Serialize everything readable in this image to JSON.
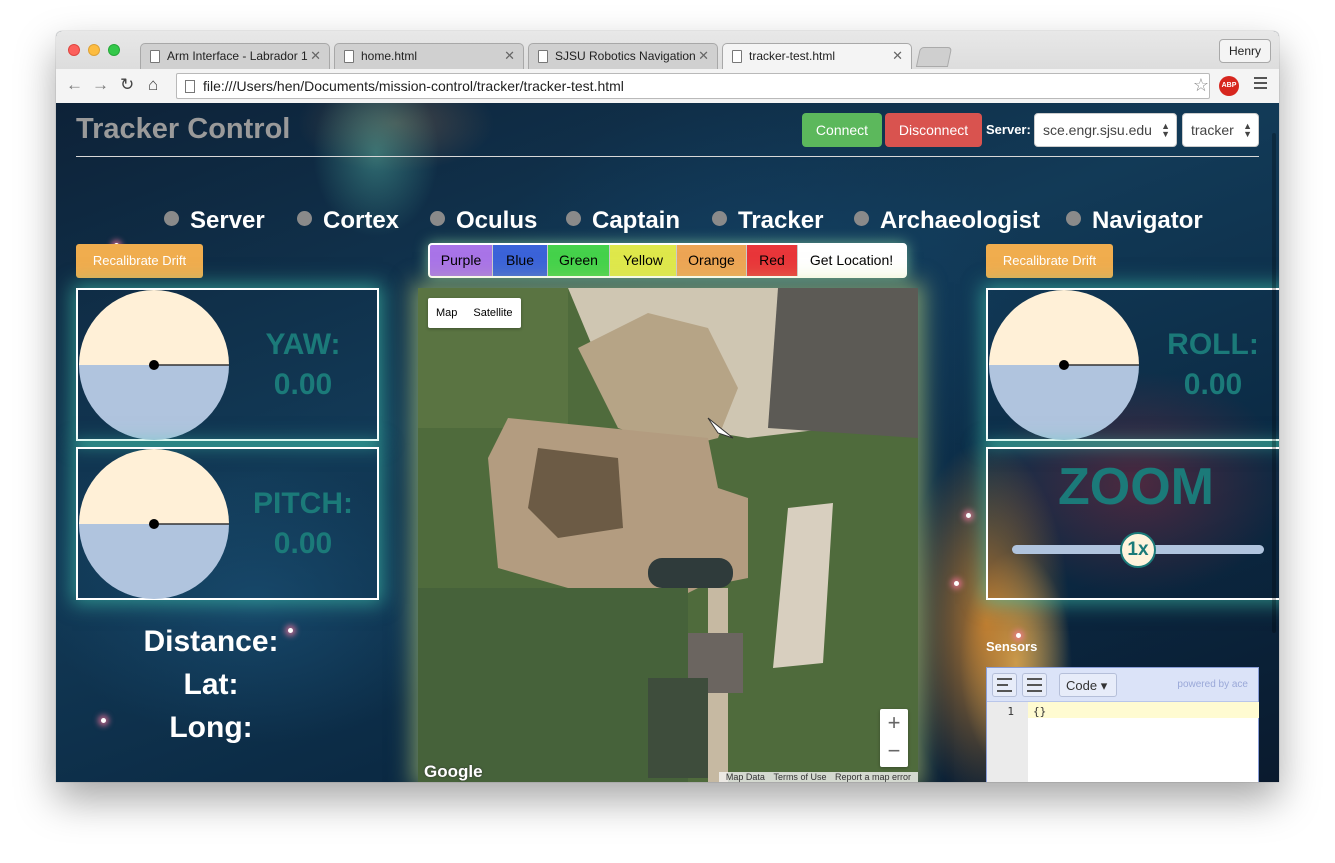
{
  "browser": {
    "tabs": [
      {
        "title": "Arm Interface - Labrador 1"
      },
      {
        "title": "home.html"
      },
      {
        "title": "SJSU Robotics Navigation"
      },
      {
        "title": "tracker-test.html"
      }
    ],
    "profile": "Henry",
    "url": "file:///Users/hen/Documents/mission-control/tracker/tracker-test.html",
    "adblock": "ABP"
  },
  "header": {
    "title": "Tracker Control",
    "connect": "Connect",
    "disconnect": "Disconnect",
    "server_label": "Server:",
    "server_value": "sce.engr.sjsu.edu",
    "node_value": "tracker"
  },
  "status": [
    {
      "label": "Server"
    },
    {
      "label": "Cortex"
    },
    {
      "label": "Oculus"
    },
    {
      "label": "Captain"
    },
    {
      "label": "Tracker"
    },
    {
      "label": "Archaeologist"
    },
    {
      "label": "Navigator"
    }
  ],
  "recalibrate_left": "Recalibrate Drift",
  "recalibrate_right": "Recalibrate Drift",
  "colors": [
    {
      "label": "Purple",
      "bg": "#a974e8"
    },
    {
      "label": "Blue",
      "bg": "#3b63d9"
    },
    {
      "label": "Green",
      "bg": "#45d24b"
    },
    {
      "label": "Yellow",
      "bg": "#dfe84b"
    },
    {
      "label": "Orange",
      "bg": "#eda555"
    },
    {
      "label": "Red",
      "bg": "#e9363a"
    },
    {
      "label": "Get Location!",
      "bg": "#ffffff"
    }
  ],
  "gauges": {
    "yaw": {
      "label": "YAW:",
      "value": "0.00"
    },
    "pitch": {
      "label": "PITCH:",
      "value": "0.00"
    },
    "roll": {
      "label": "ROLL:",
      "value": "0.00"
    }
  },
  "zoom": {
    "title": "ZOOM",
    "value": "1x"
  },
  "info": {
    "distance": "Distance:",
    "lat": "Lat:",
    "long": "Long:"
  },
  "map": {
    "type_map": "Map",
    "type_satellite": "Satellite",
    "zoom_in": "+",
    "zoom_out": "−",
    "logo": "Google",
    "footer": [
      "Map Data",
      "Terms of Use",
      "Report a map error"
    ]
  },
  "sensors": {
    "label": "Sensors",
    "mode": "Code",
    "powered": "powered by ace",
    "line_number": "1",
    "code": "{}"
  }
}
